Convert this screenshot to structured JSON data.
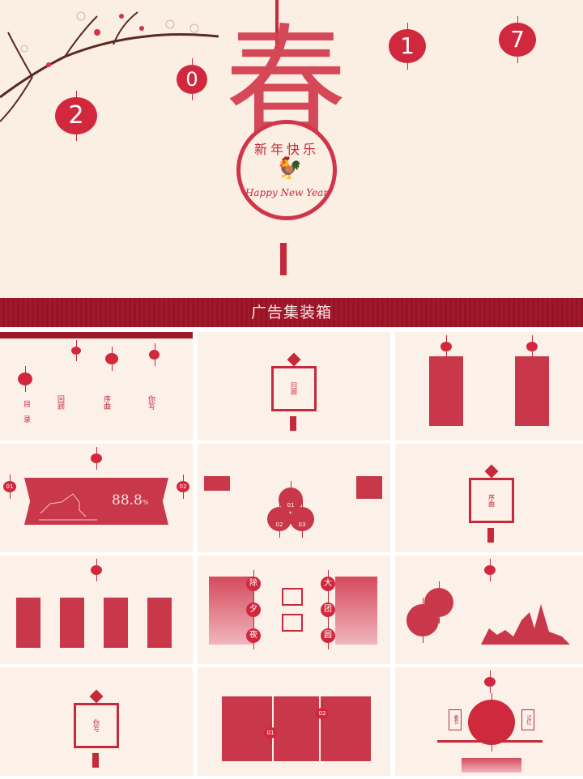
{
  "hero": {
    "main_char": "春",
    "greeting_cn": "新年快乐",
    "greeting_en": "Happy New Year",
    "year_digits": [
      "2",
      "0",
      "1",
      "7"
    ]
  },
  "banner": {
    "title": "广告集装箱"
  },
  "slides": [
    {
      "labels": [
        "目录",
        "回顾",
        "序曲",
        "你写"
      ]
    },
    {
      "label": "回顾"
    },
    {
      "label": ""
    },
    {
      "value": "88.8",
      "unit": "%",
      "left_nums": [
        "01"
      ],
      "right_nums": [
        "02"
      ]
    },
    {
      "circles": [
        "01",
        "02",
        "03"
      ]
    },
    {
      "label": "序曲"
    },
    {},
    {
      "left_chars": [
        "除",
        "夕",
        "夜"
      ],
      "right_chars": [
        "大",
        "团",
        "圆"
      ]
    },
    {},
    {
      "label": "你写"
    },
    {
      "nums": [
        "01",
        "02"
      ]
    },
    {
      "left": "春节",
      "right": "记忆"
    }
  ],
  "colors": {
    "accent": "#c42a3c",
    "banner": "#9b1b2a",
    "background": "#fbeee3"
  }
}
